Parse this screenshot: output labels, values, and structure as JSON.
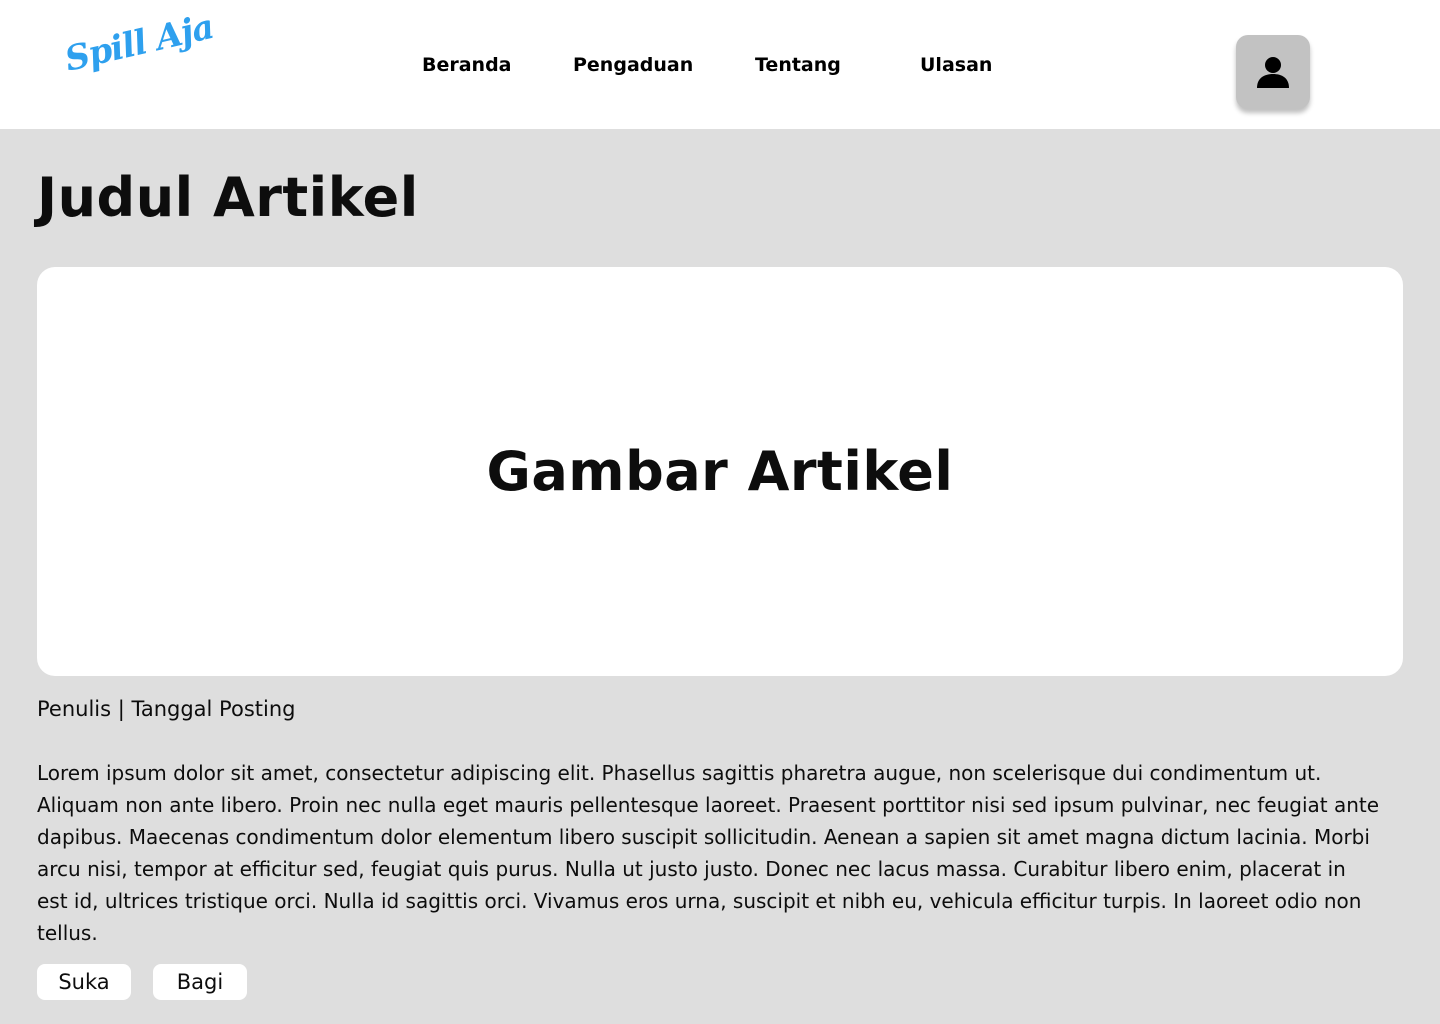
{
  "header": {
    "logo_text": "Spill Aja",
    "nav": [
      {
        "label": "Beranda"
      },
      {
        "label": "Pengaduan"
      },
      {
        "label": "Tentang"
      },
      {
        "label": "Ulasan"
      }
    ],
    "profile_icon": "user-icon"
  },
  "article": {
    "title": "Judul Artikel",
    "image_placeholder": "Gambar Artikel",
    "meta": "Penulis | Tanggal Posting",
    "body": "Lorem ipsum dolor sit amet, consectetur adipiscing elit. Phasellus sagittis pharetra augue, non scelerisque dui condimentum ut. Aliquam non ante libero. Proin nec nulla eget mauris pellentesque laoreet. Praesent porttitor nisi sed ipsum pulvinar, nec feugiat ante dapibus. Maecenas condimentum dolor elementum libero suscipit sollicitudin. Aenean a sapien sit amet magna dictum lacinia. Morbi arcu nisi, tempor at efficitur sed, feugiat quis purus. Nulla ut justo justo. Donec nec lacus massa. Curabitur libero enim, placerat in est id, ultrices tristique orci. Nulla id sagittis orci. Vivamus eros urna, suscipit et nibh eu, vehicula efficitur turpis. In laoreet odio non tellus.",
    "actions": {
      "like_label": "Suka",
      "share_label": "Bagi"
    }
  },
  "colors": {
    "brand": "#2ea0ee",
    "page_background": "#dedede",
    "surface": "#ffffff",
    "profile_button": "#c2c2c2"
  }
}
